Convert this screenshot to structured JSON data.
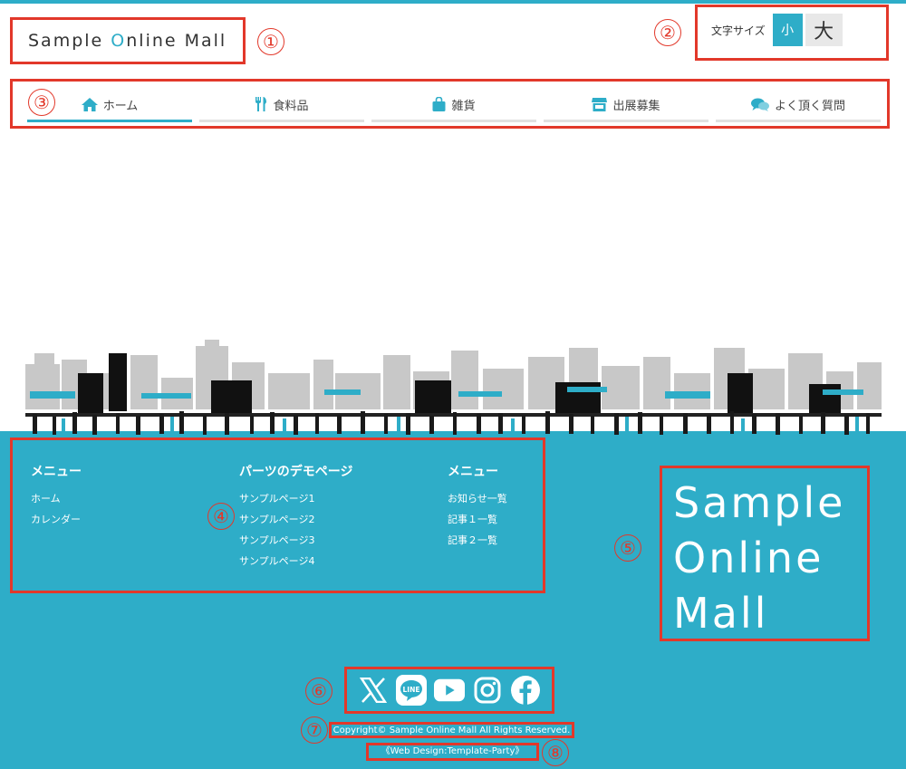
{
  "header": {
    "logo_prefix": "Sample ",
    "logo_accent": "O",
    "logo_suffix": "nline Mall",
    "fontsize_label": "文字サイズ",
    "fontsize_small": "小",
    "fontsize_large": "大"
  },
  "nav": {
    "items": [
      {
        "label": "ホーム",
        "icon": "home-icon"
      },
      {
        "label": "食料品",
        "icon": "fork-knife-icon"
      },
      {
        "label": "雑貨",
        "icon": "bag-icon"
      },
      {
        "label": "出展募集",
        "icon": "shop-icon"
      },
      {
        "label": "よく頂く質問",
        "icon": "chat-icon"
      }
    ]
  },
  "footer": {
    "col1": {
      "title": "メニュー",
      "items": [
        "ホーム",
        "カレンダー"
      ]
    },
    "col2": {
      "title": "パーツのデモページ",
      "items": [
        "サンプルページ1",
        "サンプルページ2",
        "サンプルページ3",
        "サンプルページ4"
      ]
    },
    "col3": {
      "title": "メニュー",
      "items": [
        "お知らせ一覧",
        "記事１一覧",
        "記事２一覧"
      ]
    },
    "biglogo": [
      "Sample",
      "Online",
      "Mall"
    ],
    "sns": [
      "x-icon",
      "line-icon",
      "youtube-icon",
      "instagram-icon",
      "facebook-icon"
    ],
    "line_text": "LINE",
    "copyright": "Copyright© Sample Online Mall All Rights Reserved.",
    "design_credit": "《Web Design:Template-Party》"
  },
  "annotations": [
    "①",
    "②",
    "③",
    "④",
    "⑤",
    "⑥",
    "⑦",
    "⑧"
  ],
  "colors": {
    "accent": "#2eadc8",
    "annotation": "#e2382a"
  }
}
